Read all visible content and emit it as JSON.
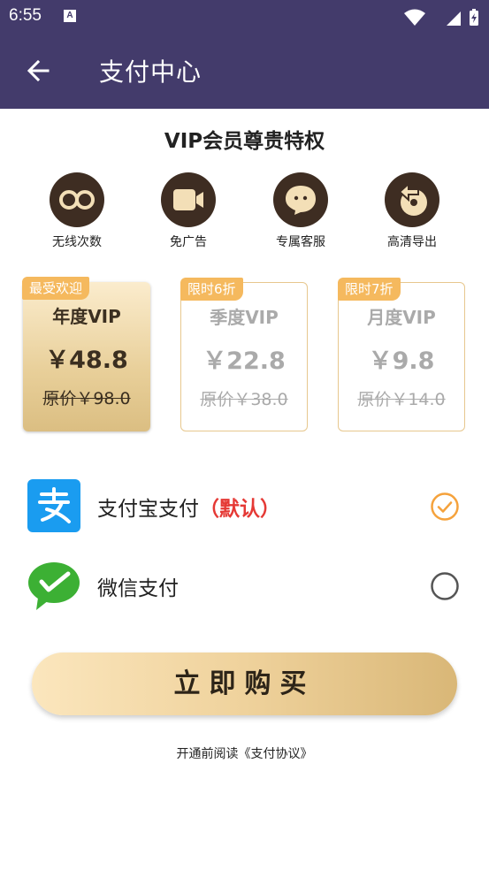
{
  "status_bar": {
    "time": "6:55",
    "notification_glyph": "A"
  },
  "app_bar": {
    "title": "支付中心",
    "back_icon": "arrow-left-icon"
  },
  "vip": {
    "title": "VIP会员尊贵特权",
    "features": [
      {
        "label": "无线次数",
        "icon": "infinity-icon"
      },
      {
        "label": "免广告",
        "icon": "video-camera-icon"
      },
      {
        "label": "专属客服",
        "icon": "chat-bubble-icon"
      },
      {
        "label": "高清导出",
        "icon": "export-icon"
      }
    ]
  },
  "plans": [
    {
      "badge": "最受欢迎",
      "name": "年度VIP",
      "price": "￥48.8",
      "original": "原价￥98.0",
      "selected": true
    },
    {
      "badge": "限时6折",
      "name": "季度VIP",
      "price": "￥22.8",
      "original": "原价￥38.0",
      "selected": false
    },
    {
      "badge": "限时7折",
      "name": "月度VIP",
      "price": "￥9.8",
      "original": "原价￥14.0",
      "selected": false
    }
  ],
  "payment": {
    "alipay": {
      "label": "支付宝支付",
      "default_tag": "（默认）",
      "selected": true,
      "icon": "alipay-icon"
    },
    "wechat": {
      "label": "微信支付",
      "selected": false,
      "icon": "wechat-pay-icon"
    }
  },
  "buy_button": "立即购买",
  "agreement": "开通前阅读《支付协议》",
  "colors": {
    "header": "#433b6b",
    "accent": "#f5b95e",
    "check": "#f5a23c",
    "default_red": "#e53935",
    "feature_bg": "#3e2d22"
  }
}
